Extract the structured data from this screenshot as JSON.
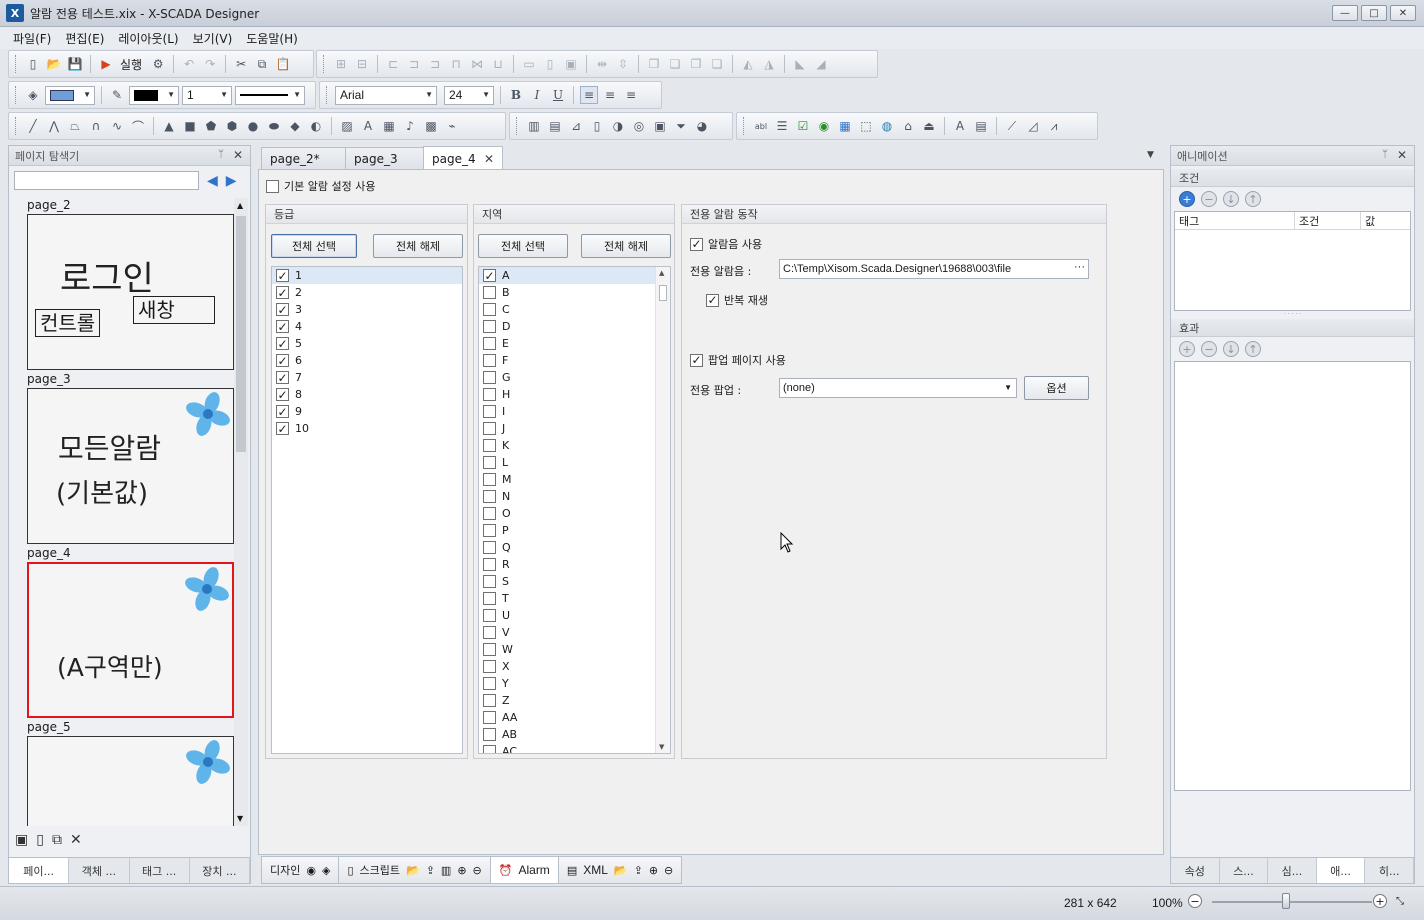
{
  "window": {
    "title": "알람 전용 테스트.xix - X-SCADA Designer",
    "app_icon": "X",
    "minimize": "—",
    "maximize": "□",
    "close": "✕"
  },
  "menu": [
    "파일(F)",
    "편집(E)",
    "레이아웃(L)",
    "보기(V)",
    "도움말(H)"
  ],
  "toolbar": {
    "run_label": "실행",
    "font_name": "Arial",
    "font_size": "24",
    "line_width": "1",
    "bold": "B",
    "italic": "I",
    "underline": "U"
  },
  "page_explorer": {
    "title": "페이지 탐색기",
    "pin": "ᛘ",
    "close": "✕",
    "search_value": "",
    "prev": "◀",
    "next": "▶",
    "pages": [
      {
        "name": "page_2",
        "text_big": "로그인",
        "box1": "컨트롤",
        "box2": "새창"
      },
      {
        "name": "page_3",
        "line1": "모든알람",
        "line2": "(기본값)"
      },
      {
        "name": "page_4",
        "line1": "(A구역만)"
      },
      {
        "name": "page_5"
      }
    ],
    "bottom_tabs": [
      "페이...",
      "객체 ...",
      "태그 ...",
      "장치 ..."
    ]
  },
  "doc_tabs": [
    {
      "label": "page_2*"
    },
    {
      "label": "page_3"
    },
    {
      "label": "page_4",
      "close": "✕"
    }
  ],
  "doc_dropdown": "▼",
  "alarm_settings": {
    "use_default_label": "기본 알람 설정 사용",
    "grade": {
      "title": "등급",
      "select_all": "전체 선택",
      "deselect_all": "전체 해제",
      "items": [
        "1",
        "2",
        "3",
        "4",
        "5",
        "6",
        "7",
        "8",
        "9",
        "10"
      ]
    },
    "region": {
      "title": "지역",
      "select_all": "전체 선택",
      "deselect_all": "전체 해제",
      "items": [
        "A",
        "B",
        "C",
        "D",
        "E",
        "F",
        "G",
        "H",
        "I",
        "J",
        "K",
        "L",
        "M",
        "N",
        "O",
        "P",
        "Q",
        "R",
        "S",
        "T",
        "U",
        "V",
        "W",
        "X",
        "Y",
        "Z",
        "AA",
        "AB",
        "AC"
      ]
    },
    "dedicated": {
      "title": "전용 알람 동작",
      "use_sound_label": "알람음 사용",
      "sound_label": "전용 알람음 :",
      "sound_value": "C:\\Temp\\Xisom.Scada.Designer\\19688\\003\\file",
      "sound_more": "···",
      "repeat_label": "반복 재생",
      "use_popup_label": "팝업 페이지 사용",
      "popup_label": "전용 팝업 :",
      "popup_value": "(none)",
      "option_button": "옵션"
    }
  },
  "doc_bottom": {
    "design": "디자인",
    "script": "스크립트",
    "alarm": "Alarm",
    "xml": "XML"
  },
  "animation_panel": {
    "title": "애니메이션",
    "pin": "ᛘ",
    "close": "✕",
    "condition_header": "조건",
    "grid_cols": [
      "태그",
      "조건",
      "값"
    ],
    "effect_header": "효과",
    "bottom_tabs": [
      "속성",
      "스...",
      "심...",
      "애...",
      "히..."
    ]
  },
  "status": {
    "size": "281 x 642",
    "zoom": "100%",
    "zoom_minus": "−",
    "zoom_plus": "+"
  }
}
